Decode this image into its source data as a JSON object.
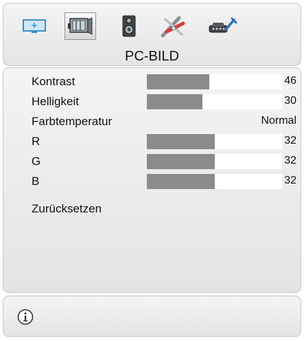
{
  "header": {
    "title": "PC-BILD",
    "tabs": [
      {
        "icon": "picture-icon"
      },
      {
        "icon": "pc-picture-icon",
        "selected": true
      },
      {
        "icon": "speaker-icon"
      },
      {
        "icon": "tools-icon"
      },
      {
        "icon": "settings-icon"
      }
    ]
  },
  "menu": {
    "items": [
      {
        "label": "Kontrast",
        "value": "46",
        "level_percent": 46
      },
      {
        "label": "Helligkeit",
        "value": "30",
        "level_percent": 41
      },
      {
        "label": "Farbtemperatur",
        "value": "Normal"
      },
      {
        "label": "R",
        "value": "32",
        "level_percent": 50
      },
      {
        "label": "G",
        "value": "32",
        "level_percent": 50
      },
      {
        "label": "B",
        "value": "32",
        "level_percent": 50
      },
      {
        "label": "Zurücksetzen"
      }
    ]
  },
  "footer": {
    "icon": "info-icon"
  },
  "colors": {
    "bar_fill": "#8b8b8b",
    "bar_track": "#ffffff",
    "panel": "#ececec"
  }
}
